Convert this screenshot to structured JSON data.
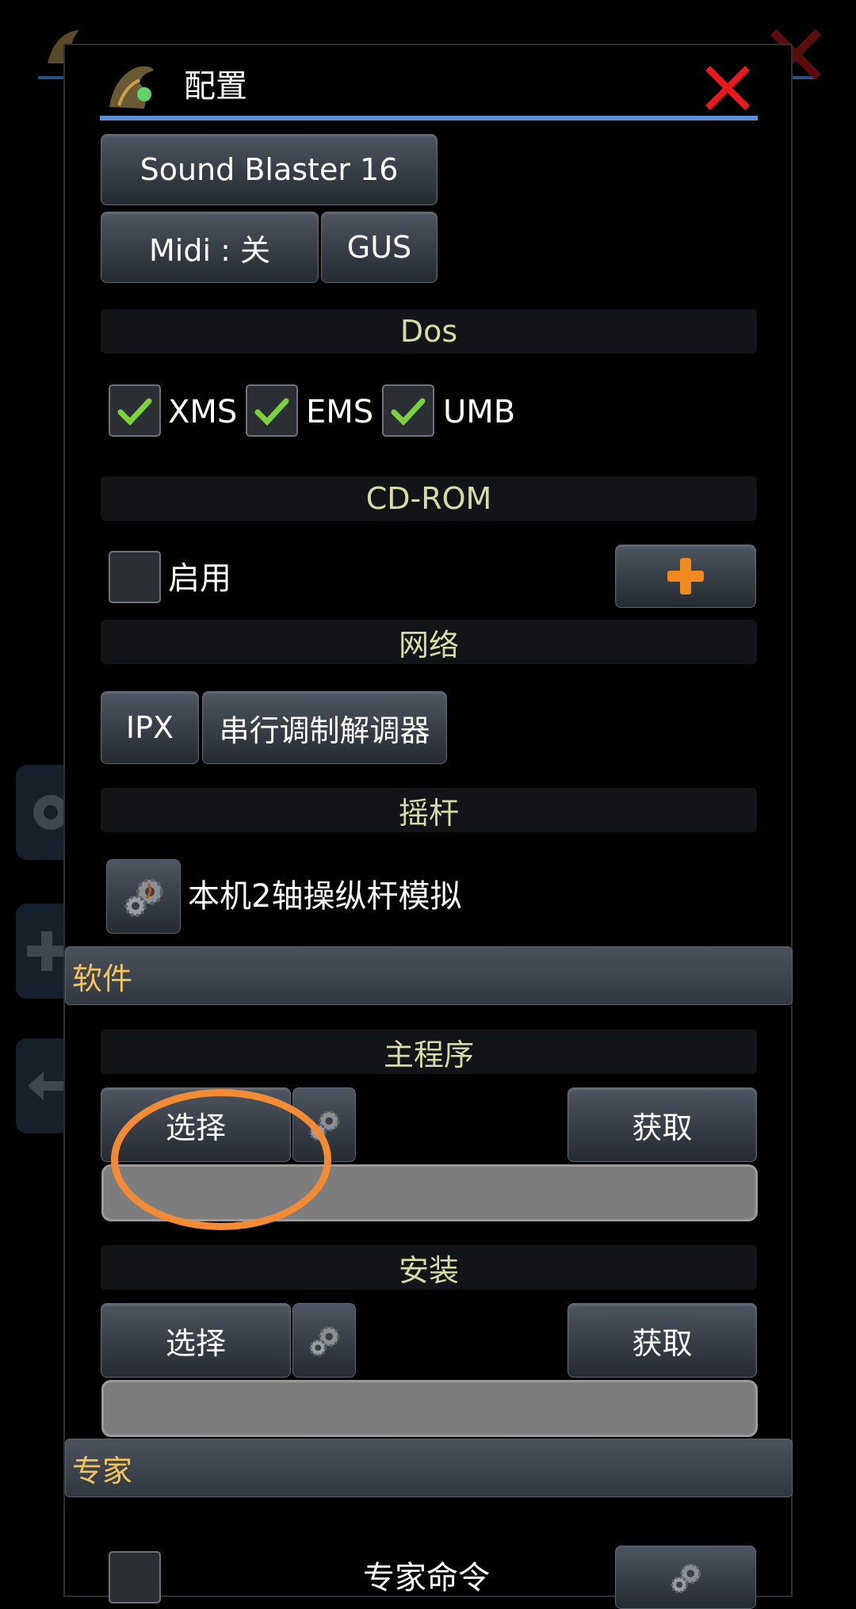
{
  "dialog": {
    "title": "配置",
    "close_icon": "red-x-close-icon"
  },
  "sound": {
    "soundcard_label": "Sound Blaster 16",
    "midi_label": "Midi : 关",
    "gus_label": "GUS"
  },
  "dos": {
    "section_label": "Dos",
    "xms_label": "XMS",
    "ems_label": "EMS",
    "umb_label": "UMB",
    "xms_checked": true,
    "ems_checked": true,
    "umb_checked": true
  },
  "cdrom": {
    "section_label": "CD-ROM",
    "enable_label": "启用",
    "enable_checked": false,
    "add_icon": "orange-plus-icon"
  },
  "network": {
    "section_label": "网络",
    "ipx_label": "IPX",
    "serial_label": "串行调制解调器"
  },
  "joystick": {
    "section_label": "摇杆",
    "mode_label": "本机2轴操纵杆模拟"
  },
  "software": {
    "group_label": "软件",
    "main_program": {
      "section_label": "主程序",
      "select_label": "选择",
      "fetch_label": "获取",
      "path_value": ""
    },
    "install": {
      "section_label": "安装",
      "select_label": "选择",
      "fetch_label": "获取",
      "path_value": ""
    }
  },
  "expert": {
    "group_label": "专家",
    "command_label": "专家命令"
  },
  "colors": {
    "accent_blue": "#5d8fd8",
    "section_text": "#d6dca3",
    "group_text": "#f3c35e",
    "check_green": "#7bd23a",
    "close_red": "#e8191f",
    "annotation_orange": "#f38b34"
  }
}
